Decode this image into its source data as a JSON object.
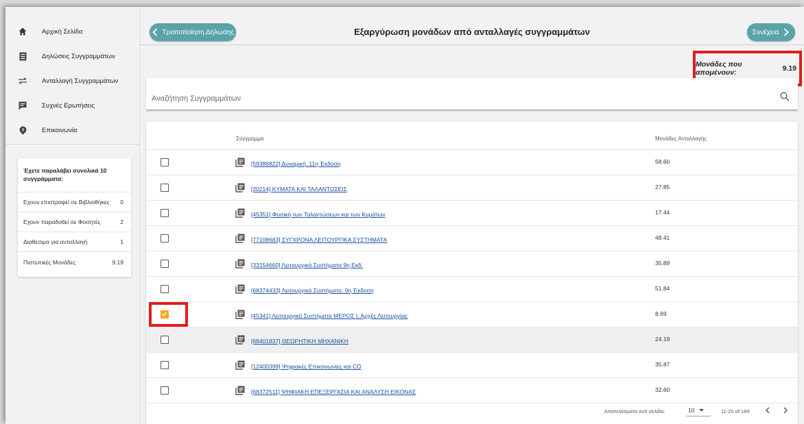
{
  "sidebar": {
    "items": [
      {
        "label": "Αρχική Σελίδα",
        "icon": "home-icon"
      },
      {
        "label": "Δηλώσεις Συγγραμμάτων",
        "icon": "document-icon"
      },
      {
        "label": "Ανταλλαγή Συγγραμμάτων",
        "icon": "exchange-arrows-icon"
      },
      {
        "label": "Συχνές Ερωτήσεις",
        "icon": "chat-icon"
      },
      {
        "label": "Επικοινωνία",
        "icon": "help-pin-icon"
      }
    ],
    "summary": {
      "title": "Έχετε παραλάβει συνολικά 10 συγγράμματα:",
      "rows": [
        {
          "label": "Εχουν επιστραφεί σε Βιβλιοθήκες",
          "value": "0"
        },
        {
          "label": "Εχουν παραδοθεί σε Φοιτητές",
          "value": "2"
        },
        {
          "label": "Διαθεσιμα για ανταλλαγή",
          "value": "1"
        },
        {
          "label": "Πιστωτικές Μονάδες",
          "value": "9.19"
        }
      ]
    }
  },
  "header": {
    "back_label": "Τροποποίηση Δήλωσης",
    "title": "Εξαργύρωση μονάδων από ανταλλαγές συγγραμμάτων",
    "continue_label": "Συνέχεια"
  },
  "remaining": {
    "label": "Μονάδες που απομένουν:",
    "value": "9.19"
  },
  "search": {
    "placeholder": "Αναζήτηση Συγγραμμάτων"
  },
  "table": {
    "columns": {
      "book": "Σύγγραμμα",
      "units": "Μονάδες Ανταλλαγής"
    },
    "rows": [
      {
        "title": "[59386822] Δυναμική, 11η Έκδοση",
        "units": "58.60",
        "checked": false
      },
      {
        "title": "[20214] ΚΥΜΑΤΑ ΚΑΙ ΤΑΛΑΝΤΩΣΕΙΣ",
        "units": "27.85",
        "checked": false
      },
      {
        "title": "[45351] Φυσική των Ταλαντώσεων και των Κυμάτων",
        "units": "17.44",
        "checked": false
      },
      {
        "title": "[77108683] ΣΥΓΧΡΟΝΑ ΛΕΙΤΟΥΡΓΙΚΑ ΣΥΣΤΗΜΑΤΑ",
        "units": "48.41",
        "checked": false
      },
      {
        "title": "[33154660] Λειτουργικά Συστήματα 9η Εκδ.",
        "units": "35.89",
        "checked": false
      },
      {
        "title": "[68374433] Λειτουργικά Συστήματα, 9η Έκδοση",
        "units": "51.84",
        "checked": false
      },
      {
        "title": "[45341] Λειτουργικά Συστήματα ΜΕΡΟΣ Ι, Αρχές Λειτουργίας",
        "units": "8.69",
        "checked": true
      },
      {
        "title": "[68401837] ΘΕΩΡΗΤΙΚΗ ΜΗΧΑΝΙΚΗ",
        "units": "24.19",
        "checked": false
      },
      {
        "title": "[12400399] Ψηφιακές Επικοινωνίες και CD",
        "units": "35.87",
        "checked": false
      },
      {
        "title": "[68372511] ΨΗΦΙΑΚΗ ΕΠΕΞΕΡΓΑΣΙΑ ΚΑΙ ΑΝΑΛΥΣΗ ΕΙΚΟΝΑΣ",
        "units": "32.60",
        "checked": false
      }
    ]
  },
  "footer": {
    "rows_per_page_label": "Αποτελέσματα ανά σελίδα:",
    "rows_per_page_value": "10",
    "range": "11-20 of 184"
  },
  "colors": {
    "accent": "#5aa3a8",
    "highlight": "#e31c1c",
    "checkbox_checked": "#f5a623",
    "link": "#1a4fa0"
  }
}
